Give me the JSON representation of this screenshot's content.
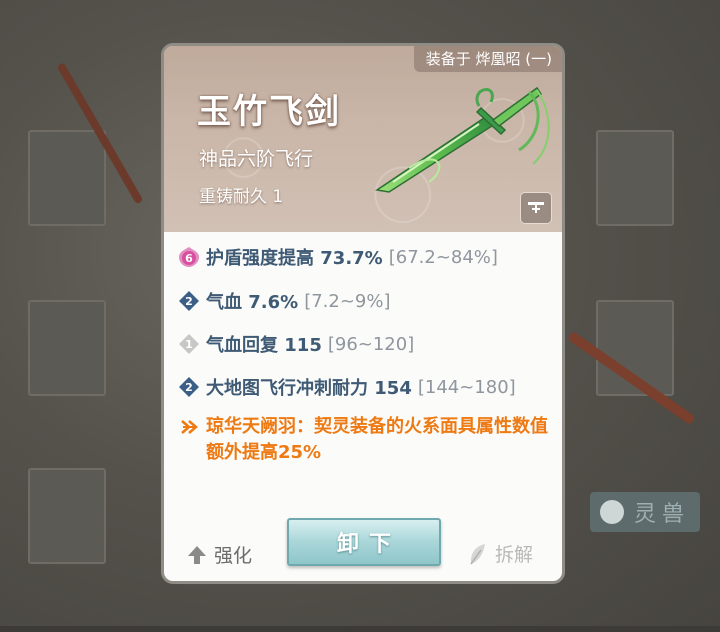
{
  "header": {
    "equipped_to": "装备于 烨凰昭 (一)",
    "item_name": "玉竹飞剑",
    "grade": "神品六阶飞行",
    "durability": "重铸耐久 1"
  },
  "stats": [
    {
      "badge": "6",
      "badge_color": "#d84fa0",
      "text": "护盾强度提高 73.7%",
      "range": "[67.2~84%]"
    },
    {
      "badge": "2",
      "badge_color": "#3b5f86",
      "text": "气血 7.6%",
      "range": "[7.2~9%]"
    },
    {
      "badge": "1",
      "badge_color": "#c7c7c7",
      "text": "气血回复 115",
      "range": "[96~120]"
    },
    {
      "badge": "2",
      "badge_color": "#3b5f86",
      "text": "大地图飞行冲刺耐力 154",
      "range": "[144~180]"
    }
  ],
  "special": {
    "text": "琼华天阙羽：契灵装备的火系面具属性数值额外提高25%",
    "color": "#ee7a14"
  },
  "actions": {
    "enhance_label": "强化",
    "unequip_label": "卸下",
    "disassemble_label": "拆解"
  },
  "background": {
    "tab_label": "灵兽"
  }
}
